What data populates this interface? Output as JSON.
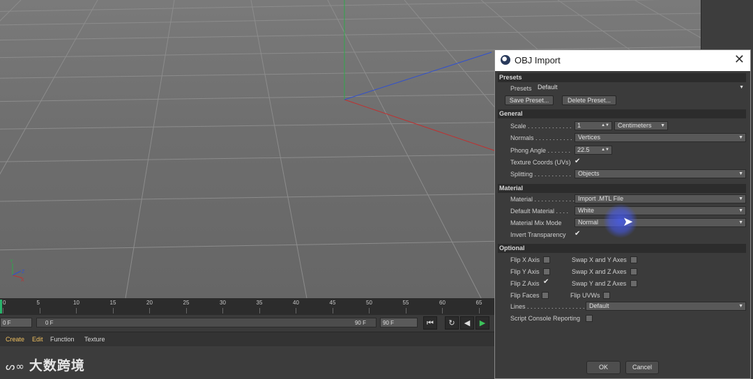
{
  "viewport": {
    "axis_labels": {
      "y": "Y",
      "z": "Z",
      "x": "X"
    }
  },
  "timeline": {
    "ticks": [
      "0",
      "5",
      "10",
      "15",
      "20",
      "25",
      "30",
      "35",
      "40",
      "45",
      "50",
      "55",
      "60",
      "65"
    ]
  },
  "transport": {
    "current_frame": "0 F",
    "range_start": "0 F",
    "range_end": "90 F",
    "end_frame": "90 F",
    "goto_start_icon": "skip-back-icon",
    "record_icon": "keyframe-record-icon",
    "step_back_icon": "step-back-icon",
    "play_icon": "play-icon"
  },
  "menubar": {
    "items": [
      "Create",
      "Edit",
      "Function",
      "Texture"
    ]
  },
  "watermark": {
    "logo": "ᔕ∞",
    "text": "大数跨境"
  },
  "dialog": {
    "title": "OBJ Import",
    "app_icon": "cinema4d-icon",
    "close_icon": "close-icon",
    "sections": {
      "presets": "Presets",
      "general": "General",
      "material": "Material",
      "optional": "Optional"
    },
    "presets": {
      "label": "Presets",
      "value": "Default",
      "save": "Save Preset...",
      "delete": "Delete Preset..."
    },
    "general": {
      "scale_label": "Scale . . . . . . . . . . . . .",
      "scale_value": "1",
      "scale_unit": "Centimeters",
      "normals_label": "Normals . . . . . . . . . . .",
      "normals_value": "Vertices",
      "phong_label": "Phong Angle . . . . . . .",
      "phong_value": "22.5",
      "texcoords_label": "Texture Coords (UVs)",
      "texcoords_checked": true,
      "splitting_label": "Splitting . . . . . . . . . . .",
      "splitting_value": "Objects"
    },
    "material": {
      "material_label": "Material . . . . . . . . . . . .",
      "material_value": "Import .MTL File",
      "default_label": "Default Material . . . .",
      "default_value": "White",
      "mix_label": "Material Mix Mode",
      "mix_value": "Normal",
      "invert_label": "Invert Transparency",
      "invert_checked": true
    },
    "optional": {
      "flip_x": "Flip X Axis",
      "flip_y": "Flip Y Axis",
      "flip_z": "Flip Z Axis",
      "flip_faces": "Flip Faces",
      "swap_xy": "Swap X and Y Axes",
      "swap_xz": "Swap X and Z Axes",
      "swap_yz": "Swap Y and Z Axes",
      "flip_uvws": "Flip UVWs",
      "lines_label": "Lines . . . . . . . . . . . . . . . . .",
      "lines_value": "Default",
      "script_label": "Script Console Reporting"
    },
    "ok": "OK",
    "cancel": "Cancel"
  },
  "colors": {
    "x_axis": "#c03030",
    "y_axis": "#2fa84a",
    "z_axis": "#3050d0",
    "dialog_bg": "#3b3b3b"
  }
}
